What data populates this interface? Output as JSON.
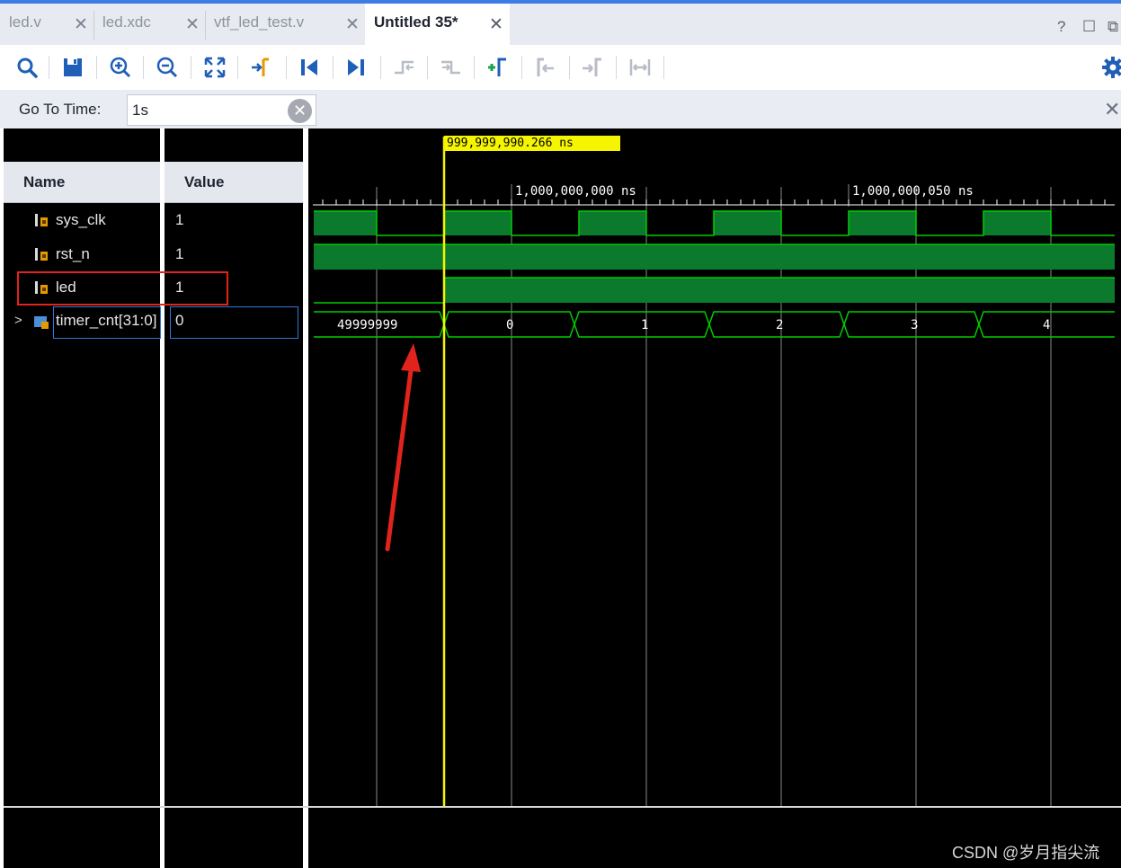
{
  "tabs": [
    {
      "label": "led.v",
      "active": false
    },
    {
      "label": "led.xdc",
      "active": false
    },
    {
      "label": "vtf_led_test.v",
      "active": false
    },
    {
      "label": "Untitled 35*",
      "active": true
    }
  ],
  "window_controls": {
    "help": "?",
    "restore": "☐"
  },
  "toolbar": {
    "items": [
      "search-icon",
      "save-icon",
      "zoom-in-icon",
      "zoom-out-icon",
      "zoom-fit-icon",
      "go-to-cursor-icon",
      "go-to-time-zero-icon",
      "go-to-last-time-icon",
      "previous-transition-icon",
      "next-transition-icon",
      "add-marker-icon",
      "previous-marker-icon",
      "next-marker-icon",
      "swap-cursors-icon",
      "settings-gear-icon"
    ],
    "accent_color": "#1f6fd1"
  },
  "goto": {
    "label": "Go To Time:",
    "value": "1s"
  },
  "columns": {
    "name": "Name",
    "value": "Value"
  },
  "signals": [
    {
      "name": "sys_clk",
      "value": "1",
      "icon": "signal-bit-icon"
    },
    {
      "name": "rst_n",
      "value": "1",
      "icon": "signal-bit-icon"
    },
    {
      "name": "led",
      "value": "1",
      "icon": "signal-bit-icon",
      "highlighted": true
    },
    {
      "name": "timer_cnt[31:0]",
      "value": "0",
      "icon": "signal-bus-icon",
      "expandable": true,
      "selected": true
    }
  ],
  "waveform": {
    "cursor_time": "999,999,990.266 ns",
    "ticks": [
      "1,000,000,000 ns",
      "1,000,000,050 ns"
    ],
    "bus_values": [
      "49999999",
      "0",
      "1",
      "2",
      "3",
      "4"
    ],
    "wave_color": "#00cc00",
    "wave_fill": "#0b7a2c",
    "cursor_color": "#f5f500",
    "highlight_color": "#e0241b"
  },
  "watermark": "CSDN @岁月指尖流"
}
